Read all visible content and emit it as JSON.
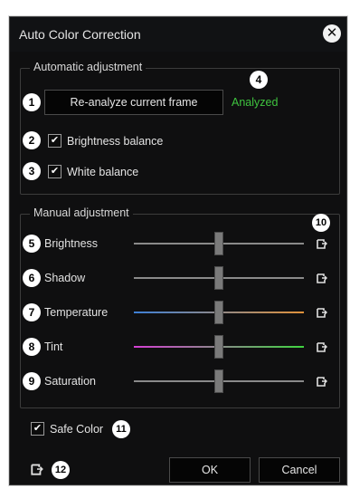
{
  "dialog": {
    "title": "Auto Color Correction"
  },
  "auto": {
    "group_label": "Automatic adjustment",
    "reanalyze_label": "Re-analyze current frame",
    "status": "Analyzed",
    "brightness_balance": {
      "label": "Brightness balance",
      "checked": true
    },
    "white_balance": {
      "label": "White balance",
      "checked": true
    }
  },
  "manual": {
    "group_label": "Manual adjustment",
    "sliders": [
      {
        "label": "Brightness",
        "level": 0.5,
        "track": "gray"
      },
      {
        "label": "Shadow",
        "level": 0.5,
        "track": "gray"
      },
      {
        "label": "Temperature",
        "level": 0.5,
        "track": "blue-orange"
      },
      {
        "label": "Tint",
        "level": 0.5,
        "track": "magenta-green"
      },
      {
        "label": "Saturation",
        "level": 0.5,
        "track": "gray"
      }
    ]
  },
  "safe_color": {
    "label": "Safe Color",
    "checked": true
  },
  "footer": {
    "ok_label": "OK",
    "cancel_label": "Cancel"
  },
  "badges": [
    "1",
    "2",
    "3",
    "4",
    "5",
    "6",
    "7",
    "8",
    "9",
    "10",
    "11",
    "12"
  ],
  "colors": {
    "status_green": "#3fc43f",
    "temp_start": "#3d7fd6",
    "temp_end": "#e0913a",
    "tint_start": "#d43fd4",
    "tint_end": "#3fd43f"
  }
}
